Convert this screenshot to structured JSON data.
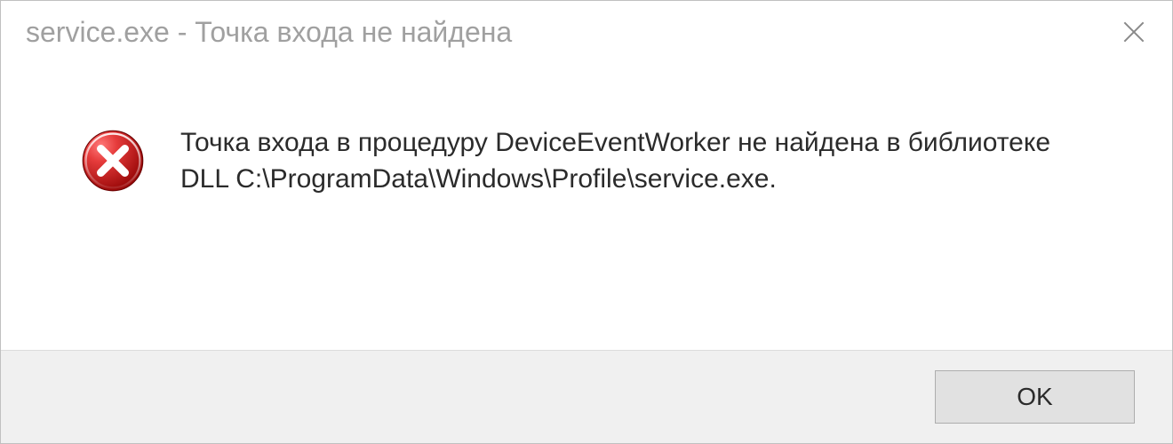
{
  "titlebar": {
    "title": "service.exe - Точка входа не найдена"
  },
  "content": {
    "message": "Точка входа в процедуру DeviceEventWorker не найдена в библиотеке DLL C:\\ProgramData\\Windows\\Profile\\service.exe."
  },
  "buttons": {
    "ok_label": "OK"
  }
}
